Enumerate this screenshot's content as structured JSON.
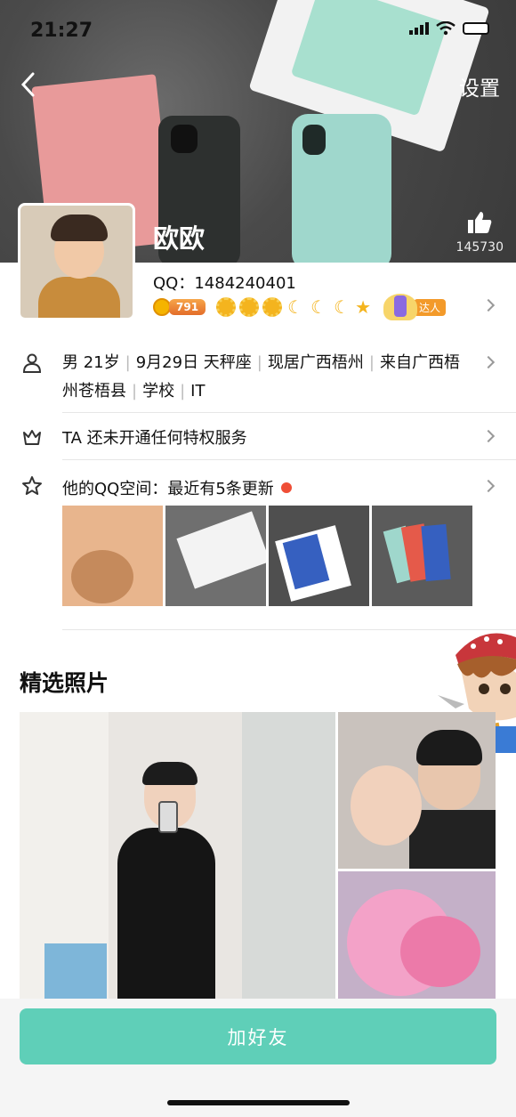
{
  "status": {
    "time": "21:27"
  },
  "header": {
    "settings": "设置"
  },
  "profile": {
    "nickname": "欧欧",
    "likes": "145730",
    "qq_label": "QQ：",
    "qq_number": "1484240401",
    "coin_level": "791",
    "talent_tag": "达人"
  },
  "info": {
    "items": [
      "男 21岁",
      "9月29日 天秤座",
      "现居广西梧州",
      "来自广西梧州苍梧县",
      "学校",
      "IT"
    ],
    "privilege": "TA 还未开通任何特权服务",
    "qzone_label": "他的QQ空间：",
    "qzone_update": "最近有5条更新"
  },
  "photos": {
    "section_title": "精选照片"
  },
  "actions": {
    "add_friend": "加好友"
  },
  "colors": {
    "accent": "#5fcfb8",
    "dot": "#ef4e36",
    "gold": "#f4b41e"
  }
}
